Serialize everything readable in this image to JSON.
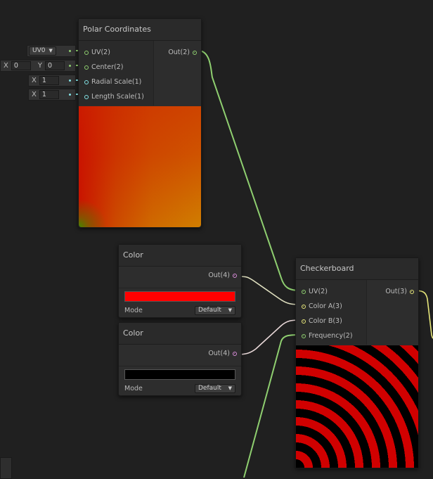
{
  "colors": {
    "background": "#202020",
    "wire_vector2": "#8fcf70",
    "wire_vector1": "#84e4e7",
    "wire_vector3": "#e6e67a",
    "wire_vector4": "#d68bd6",
    "swatch_red": "#ff0000",
    "swatch_black": "#000000"
  },
  "polar": {
    "title": "Polar Coordinates",
    "inputs": [
      "UV(2)",
      "Center(2)",
      "Radial Scale(1)",
      "Length Scale(1)"
    ],
    "output": "Out(2)"
  },
  "inline_inputs": {
    "uv_channel": "UV0",
    "center_x_label": "X",
    "center_x": "0",
    "center_y_label": "Y",
    "center_y": "0",
    "radial_label": "X",
    "radial_value": "1",
    "length_label": "X",
    "length_value": "1"
  },
  "color_node_1": {
    "title": "Color",
    "output": "Out(4)",
    "mode_label": "Mode",
    "mode_value": "Default",
    "swatch": "#ff0000"
  },
  "color_node_2": {
    "title": "Color",
    "output": "Out(4)",
    "mode_label": "Mode",
    "mode_value": "Default",
    "swatch": "#000000"
  },
  "checkerboard": {
    "title": "Checkerboard",
    "inputs": [
      "UV(2)",
      "Color A(3)",
      "Color B(3)",
      "Frequency(2)"
    ],
    "output": "Out(3)"
  }
}
